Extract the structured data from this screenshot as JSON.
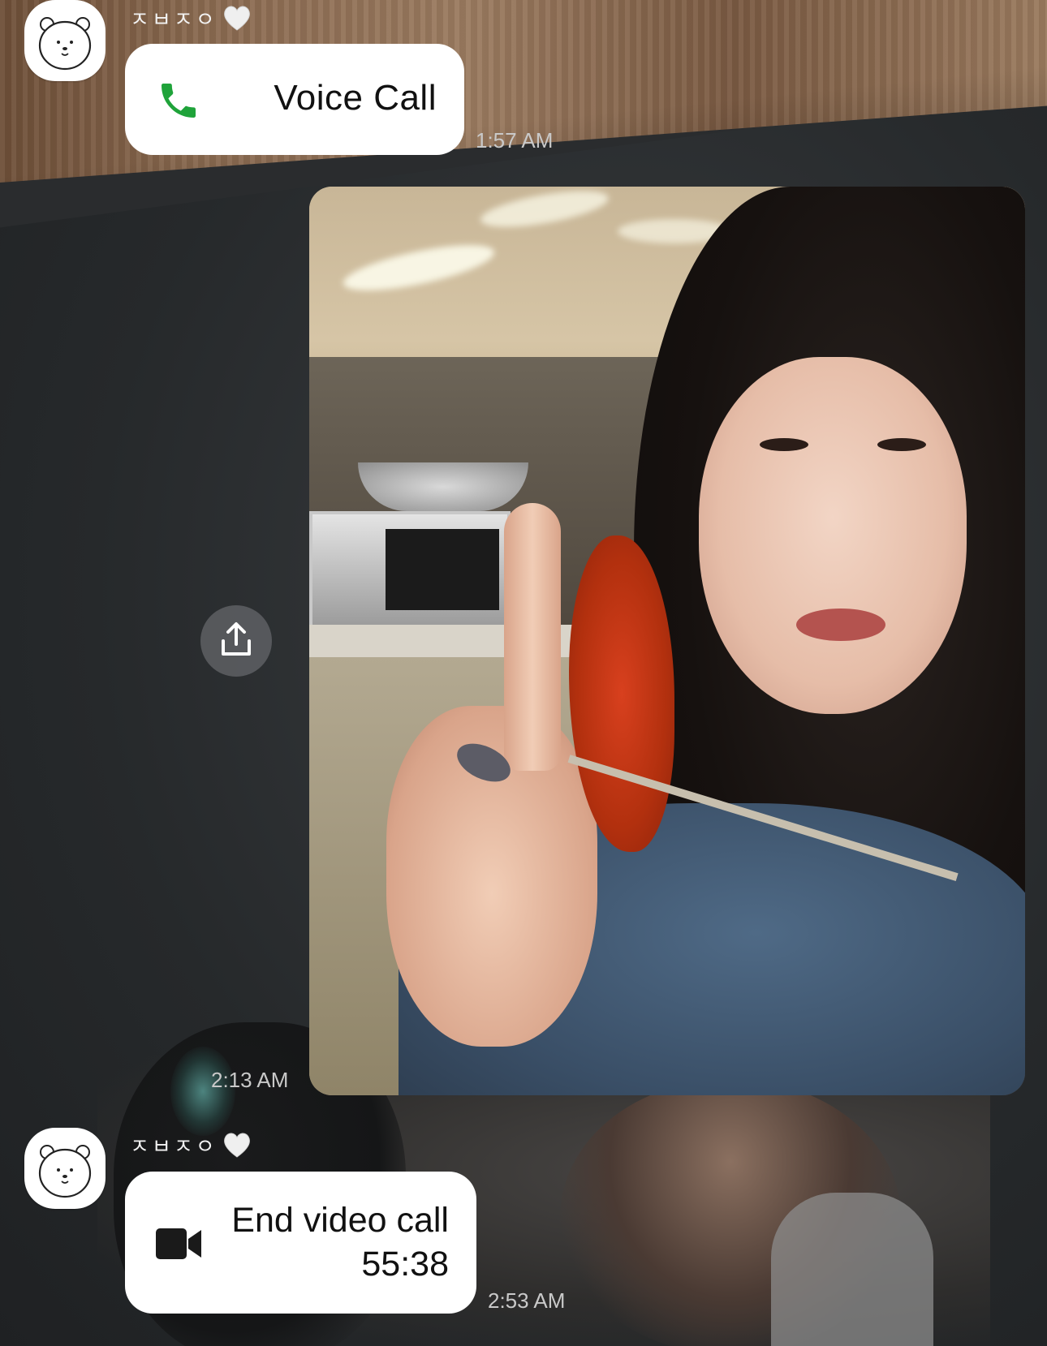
{
  "wallpaper": {
    "description_colors": {
      "wood": "#8a6a50",
      "wall": "#2a2c2e"
    }
  },
  "messages": [
    {
      "type": "call",
      "sender": "ㅈㅂㅈㅇ",
      "sender_emoji": "heart-white",
      "label": "Voice Call",
      "icon": "phone-icon",
      "icon_color": "#1fa33a",
      "time": "1:57 AM"
    },
    {
      "type": "photo",
      "time": "2:13 AM",
      "share_icon": "share-icon"
    },
    {
      "type": "call",
      "sender": "ㅈㅂㅈㅇ",
      "sender_emoji": "heart-white",
      "label": "End video call",
      "duration": "55:38",
      "icon": "video-camera-icon",
      "time": "2:53 AM"
    }
  ]
}
